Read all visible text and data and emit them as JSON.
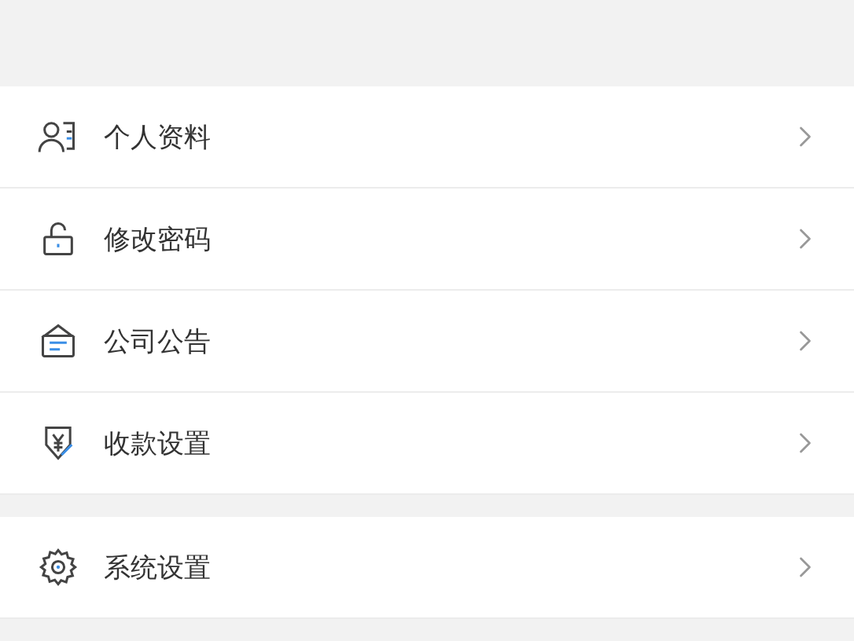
{
  "sections": [
    {
      "items": [
        {
          "kind": "profile",
          "label": "个人资料"
        },
        {
          "kind": "lock",
          "label": "修改密码"
        },
        {
          "kind": "notice",
          "label": "公司公告"
        },
        {
          "kind": "payment",
          "label": "收款设置"
        }
      ]
    },
    {
      "items": [
        {
          "kind": "settings",
          "label": "系统设置"
        }
      ]
    }
  ]
}
